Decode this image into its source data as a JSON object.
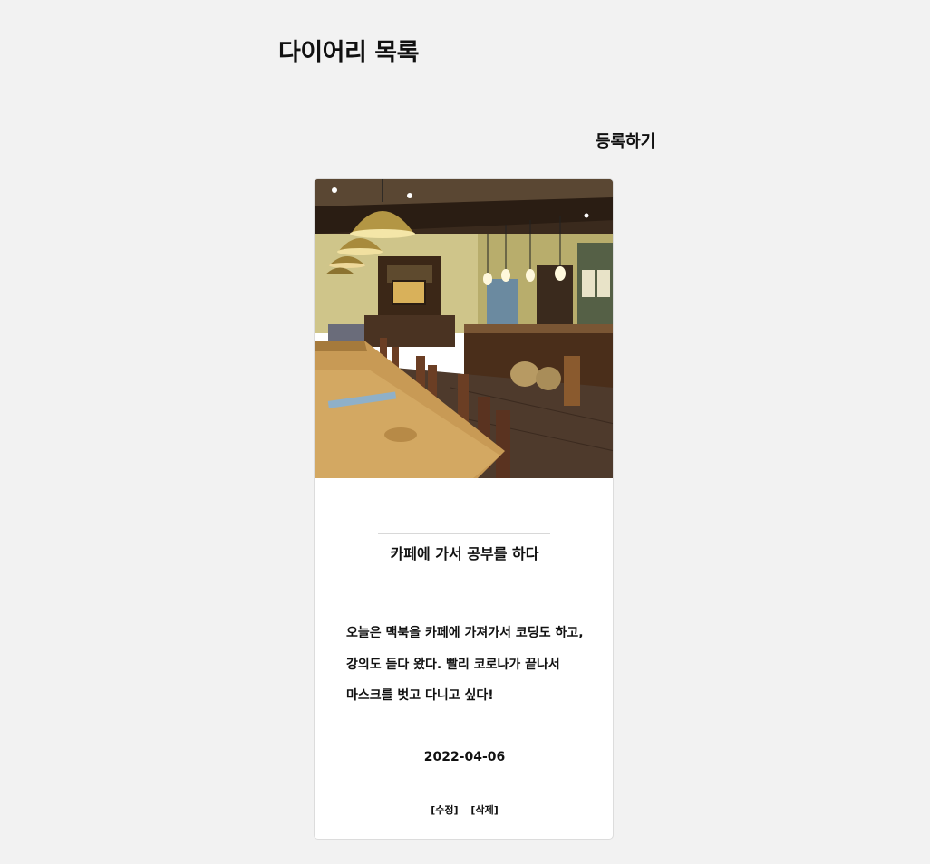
{
  "header": {
    "title": "다이어리 목록",
    "register_label": "등록하기"
  },
  "diary": {
    "entry": {
      "photo_alt": "카페 내부 사진",
      "title": "카페에 가서 공부를 하다",
      "body": "오늘은 맥북을 카페에 가져가서 코딩도 하고, 강의도 듣다 왔다. 빨리 코로나가 끝나서 마스크를 벗고 다니고 싶다!",
      "date": "2022-04-06",
      "edit_label": "[수정]",
      "delete_label": "[삭제]"
    }
  },
  "colors": {
    "background": "#f2f2f2",
    "card": "#ffffff",
    "text": "#111111"
  }
}
